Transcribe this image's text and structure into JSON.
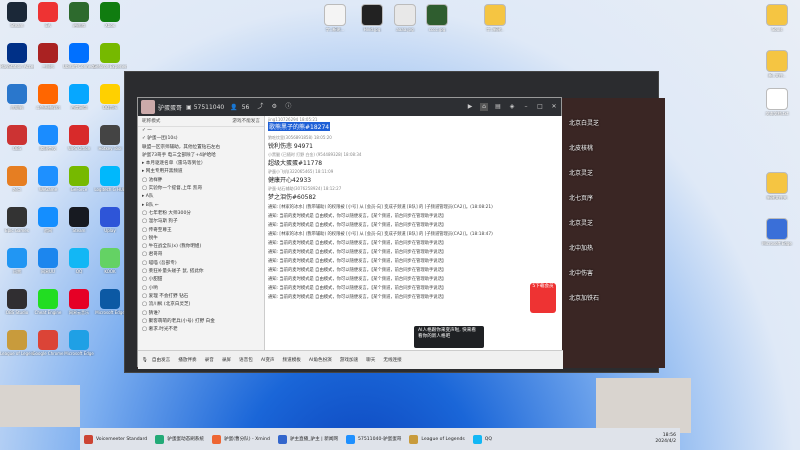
{
  "desktop_left": [
    {
      "label": "Steam",
      "color": "#1b2838"
    },
    {
      "label": "EA",
      "color": "#e33"
    },
    {
      "label": "逍遥游",
      "color": "#2d6a2d"
    },
    {
      "label": "Xbox",
      "color": "#107c10"
    },
    {
      "label": "PlayStation Accessories",
      "color": "#003087"
    },
    {
      "label": "三国志",
      "color": "#a22"
    },
    {
      "label": "Ubisoft Connect",
      "color": "#0070ff"
    },
    {
      "label": "Geforce Experience",
      "color": "#76b900"
    },
    {
      "label": "此电脑",
      "color": "#2a77cc"
    },
    {
      "label": "斗鱼直播伴侣",
      "color": "#ff6600"
    },
    {
      "label": "百度网盘",
      "color": "#06a7ff"
    },
    {
      "label": "QQ音乐",
      "color": "#ffd000"
    },
    {
      "label": "OBS",
      "color": "#cc3333"
    },
    {
      "label": "腾讯会议",
      "color": "#1a8cff"
    },
    {
      "label": "WPS Office",
      "color": "#d82a2a"
    },
    {
      "label": "Hotkey Tool",
      "color": "#444"
    },
    {
      "label": "起点",
      "color": "#e67e22"
    },
    {
      "label": "WeGame",
      "color": "#1e90ff"
    },
    {
      "label": "GeForce",
      "color": "#76b900"
    },
    {
      "label": "Logitech G HUB",
      "color": "#00b8fc"
    },
    {
      "label": "Epic Games",
      "color": "#333"
    },
    {
      "label": "战网",
      "color": "#148eff"
    },
    {
      "label": "Steam",
      "color": "#171a21"
    },
    {
      "label": "Uplay",
      "color": "#2e55d8"
    },
    {
      "label": "迅雷",
      "color": "#2196f3"
    },
    {
      "label": "网易UU",
      "color": "#1c86ee"
    },
    {
      "label": "QQ",
      "color": "#12b7f5"
    },
    {
      "label": "KOOK",
      "color": "#64d264"
    },
    {
      "label": "OBS Studio",
      "color": "#302e31"
    },
    {
      "label": "Cheat Engine",
      "color": "#2d2"
    },
    {
      "label": "网易云音乐",
      "color": "#e60026"
    },
    {
      "label": "Microsoft Edge",
      "color": "#0c59a4"
    },
    {
      "label": "League of Legends",
      "color": "#c89b3c"
    },
    {
      "label": "Google Chrome",
      "color": "#db4437"
    },
    {
      "label": "Microsoft Edge",
      "color": "#1fa0e5"
    }
  ],
  "desktop_top": [
    {
      "label": "字..新建...",
      "color": "#f4f4f4"
    },
    {
      "label": "Hvid.jpg",
      "color": "#222"
    },
    {
      "label": "aaaa.jpg",
      "color": "#e8e8e8"
    },
    {
      "label": "cccc.jpg",
      "color": "#2f5d2f"
    },
    {
      "label": "字..新建..",
      "color": "#f5c542"
    },
    {
      "label": "Souls",
      "color": "#f5c542"
    },
    {
      "label": "新..文件..",
      "color": "#f5c542"
    },
    {
      "label": "文本文档.txt",
      "color": "#fff"
    },
    {
      "label": "新建文件夹",
      "color": "#f5c542"
    },
    {
      "label": "Microsoft Edge",
      "color": "#3a6fd8"
    }
  ],
  "window": {
    "room_name": "驴蛋蛋哥",
    "room_id": "57511040",
    "viewer_count": "56",
    "icons": [
      "video-icon",
      "home-icon",
      "layout-icon",
      "gamepad-icon",
      "minimize-icon",
      "maximize-icon",
      "close-icon"
    ]
  },
  "left_panel": {
    "filter_label": "昵称模式",
    "tab_label": "游戏不能发言",
    "items": [
      "✓ 一",
      "✓ 驴蛋一团(10s)",
      "联盟一区宗师辅助，其他位置钻石左右",
      "驴蛋73哥手 电三全部除了+4驴哈哈",
      "▸ 本月驱逐名单（雷马等到位）",
      "▸ 网主专用开黑频道",
      "◯ 池样胖",
      "◯ 实验你一个提督,上年 凯哥",
      "▸ A队",
      "▸ B队 ←",
      "◯ 七年老粉 大师300分",
      "◯ 温尔马斯 狗子",
      "◯ 传奇至尊王",
      "◯ 锐牛",
      "◯ 牛在战全队(x) (我你明姐)",
      "◯ 君哥哥",
      "◯ 喵喵 (吾部专)",
      "◯ 莱狂补量头碰子 鼠, 搭此你",
      "◯ 小甜甜",
      "◯ 小哟",
      "◯ 爱理 不会打野 钻石",
      "◯ 流川枫 (北京白灵芝)",
      "◯ 猜谁？",
      "◯ 聚客萌萌的老兵(小号) 打野 白金",
      "◯ 奢求.时光不老"
    ]
  },
  "chat": {
    "messages": [
      {
        "meta": "jing110726294 18:05:21",
        "text": "歌熊黑子的熊#18274",
        "highlight": true
      },
      {
        "meta": "狼吃饮里(3056891858) 18:05:20",
        "text": "锐利伤悲 94971",
        "highlight": false
      },
      {
        "meta": "小黑腿 (已随时 打野 白金) (954489328) 18:08:34",
        "text": "超级大蛋蛋#11778",
        "highlight": false
      },
      {
        "meta": "驴蛋小飞机(322065465) 18:11:09",
        "text": "健康开心42933",
        "highlight": false
      },
      {
        "meta": "驴蛋-站石辅助(3076258924) 18:12:27",
        "text": "梦之泪伤#60582",
        "highlight": false
      }
    ],
    "system_lines": [
      "通知: [林家的冰水] (我带辅助) 的权限被 [小号] 从 [会员-向] 变成子频道 [B队] 的 [子频道管理员(CA2)]。(18:08:21)",
      "通知: 当前的麦时模式是 自由模式，你可以随便发言。【某个频道，前台同步在管理助手说话】",
      "通知: 当前的麦时模式是 自由模式，你可以随便发言。【某个频道，前台同步在管理助手说话】",
      "通知: [林家的冰水] (我带辅助) 的权限被 [小号] 从 [会员-向] 变成子频道 [B队] 的 [子频道管理员(CA2)]。(18:18:47)",
      "通知: 当前的麦时模式是 自由模式，你可以随便发言。【某个频道，前台同步在管理助手说话】",
      "通知: 当前的麦时模式是 自由模式，你可以随便发言。【某个频道，前台同步在管理助手说话】",
      "通知: 当前的麦时模式是 自由模式，你可以随便发言。【某个频道，前台同步在管理助手说话】",
      "通知: 当前的麦时模式是 自由模式，你可以随便发言。【某个频道，前台同步在管理助手说话】",
      "通知: 当前的麦时模式是 自由模式，你可以随便发言。【某个频道，前台同步在管理助手说话】",
      "通知: 当前的麦时模式是 自由模式，你可以随便发言。【某个频道，前台同步在管理助手说话】",
      "通知: 当前的麦时模式是 自由模式，你可以随便发言。【某个频道，前台同步在管理助手说话】"
    ]
  },
  "bottom_bar": {
    "items": [
      "自由发言",
      "播放伴奏",
      "录音",
      "录屏",
      "语音包",
      "AI变声",
      "频道模板",
      "AI角色扮演",
      "游戏加速",
      "聊天",
      "无线连接"
    ]
  },
  "tooltip": {
    "text": "AI人格跟你来变声啦, 快来看看你的新人格吧"
  },
  "overlay": {
    "badge": "5下载会员",
    "right_texts": [
      "北京白灵芝",
      "北皮核桃",
      "北京灵芝",
      "北七页序",
      "北京灵芝",
      "北中加热",
      "北中伤害",
      "北京加铁石"
    ]
  },
  "taskbar": {
    "apps": [
      {
        "label": "Voicemeeter Standard",
        "color": "#c43"
      },
      {
        "label": "驴蛋蛋动态刷系统",
        "color": "#2a7"
      },
      {
        "label": "驴蛋(曹分队) - Xmind",
        "color": "#e63"
      },
      {
        "label": "驴主直播_驴主 | 新闻网",
        "color": "#36c"
      },
      {
        "label": "57511040-驴蛋蛋哥",
        "color": "#1e90ff"
      },
      {
        "label": "League of Legends",
        "color": "#c89b3c"
      },
      {
        "label": "QQ",
        "color": "#12b7f5"
      }
    ],
    "time": "18:56",
    "date": "2024/4/2"
  }
}
